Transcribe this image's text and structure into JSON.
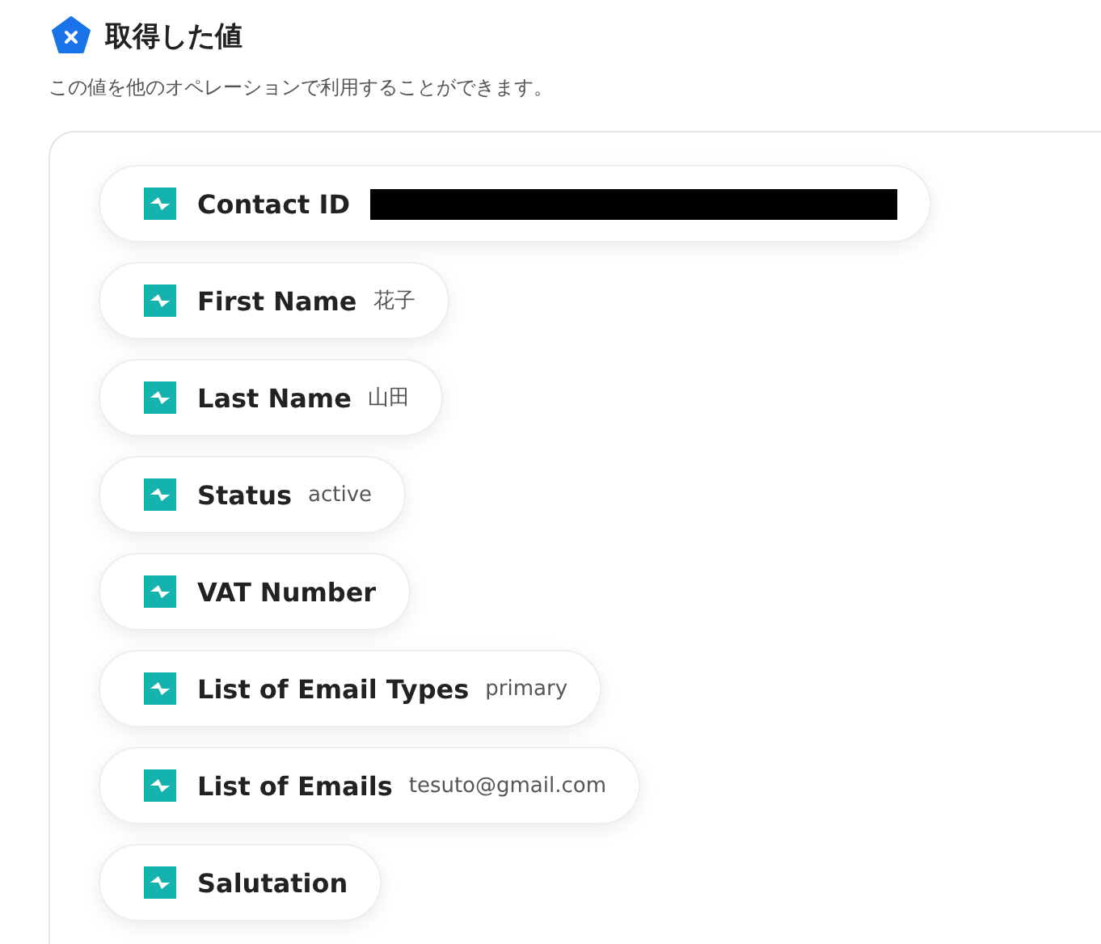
{
  "header": {
    "title": "取得した値",
    "description": "この値を他のオペレーションで利用することができます。"
  },
  "fields": [
    {
      "label": "Contact ID",
      "redacted": true
    },
    {
      "label": "First Name",
      "value": "花子"
    },
    {
      "label": "Last Name",
      "value": "山田"
    },
    {
      "label": "Status",
      "value": "active"
    },
    {
      "label": "VAT Number"
    },
    {
      "label": "List of Email Types",
      "value": "primary"
    },
    {
      "label": "List of Emails",
      "value": "tesuto@gmail.com"
    },
    {
      "label": "Salutation"
    }
  ]
}
